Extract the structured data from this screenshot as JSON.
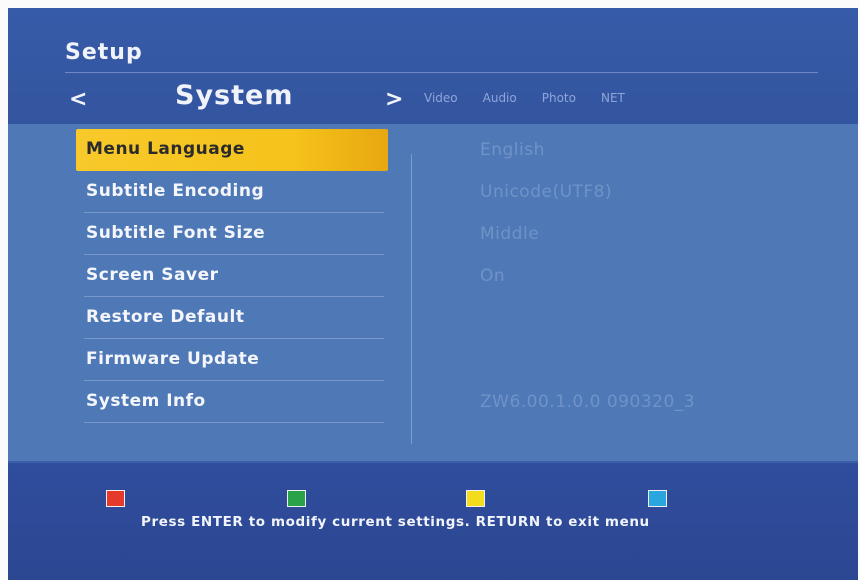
{
  "header": {
    "title": "Setup",
    "section": "System",
    "prev_arrow": "<",
    "next_arrow": ">",
    "tabs": [
      "Video",
      "Audio",
      "Photo",
      "NET"
    ]
  },
  "menu": {
    "items": [
      {
        "label": "Menu Language",
        "value": "English",
        "selected": true
      },
      {
        "label": "Subtitle Encoding",
        "value": "Unicode(UTF8)"
      },
      {
        "label": "Subtitle Font Size",
        "value": "Middle"
      },
      {
        "label": "Screen Saver",
        "value": "On"
      },
      {
        "label": "Restore Default",
        "value": ""
      },
      {
        "label": "Firmware Update",
        "value": ""
      },
      {
        "label": "System Info",
        "value": "ZW6.00.1.0.0 090320_3"
      }
    ]
  },
  "footer": {
    "hint": "Press ENTER to modify current settings. RETURN to exit menu",
    "color_keys": [
      "red",
      "green",
      "yellow",
      "blue"
    ]
  },
  "colors": {
    "accent_selected": "#f6c21b",
    "panel": "#4f79b6",
    "header": "#365ba8"
  }
}
